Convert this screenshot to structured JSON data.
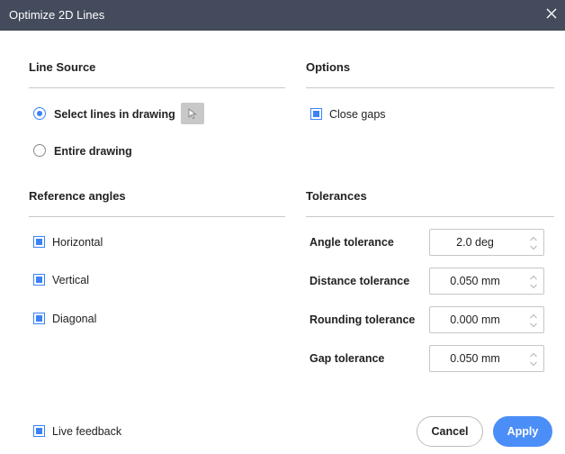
{
  "window": {
    "title": "Optimize 2D Lines"
  },
  "line_source": {
    "heading": "Line Source",
    "options": [
      {
        "label": "Select lines in drawing",
        "selected": true
      },
      {
        "label": "Entire drawing",
        "selected": false
      }
    ],
    "pick_icon": "cursor-select-icon"
  },
  "options": {
    "heading": "Options",
    "close_gaps": {
      "label": "Close gaps",
      "checked": true
    }
  },
  "reference_angles": {
    "heading": "Reference angles",
    "items": [
      {
        "label": "Horizontal",
        "checked": true
      },
      {
        "label": "Vertical",
        "checked": true
      },
      {
        "label": "Diagonal",
        "checked": true
      }
    ]
  },
  "tolerances": {
    "heading": "Tolerances",
    "items": [
      {
        "label": "Angle tolerance",
        "value": "2.0 deg"
      },
      {
        "label": "Distance tolerance",
        "value": "0.050 mm"
      },
      {
        "label": "Rounding tolerance",
        "value": "0.000 mm"
      },
      {
        "label": "Gap tolerance",
        "value": "0.050 mm"
      }
    ]
  },
  "footer": {
    "live_feedback": {
      "label": "Live feedback",
      "checked": true
    },
    "cancel_label": "Cancel",
    "apply_label": "Apply"
  },
  "colors": {
    "titlebar": "#434b5c",
    "accent": "#3b82f6",
    "apply_button": "#4c8ef7"
  }
}
